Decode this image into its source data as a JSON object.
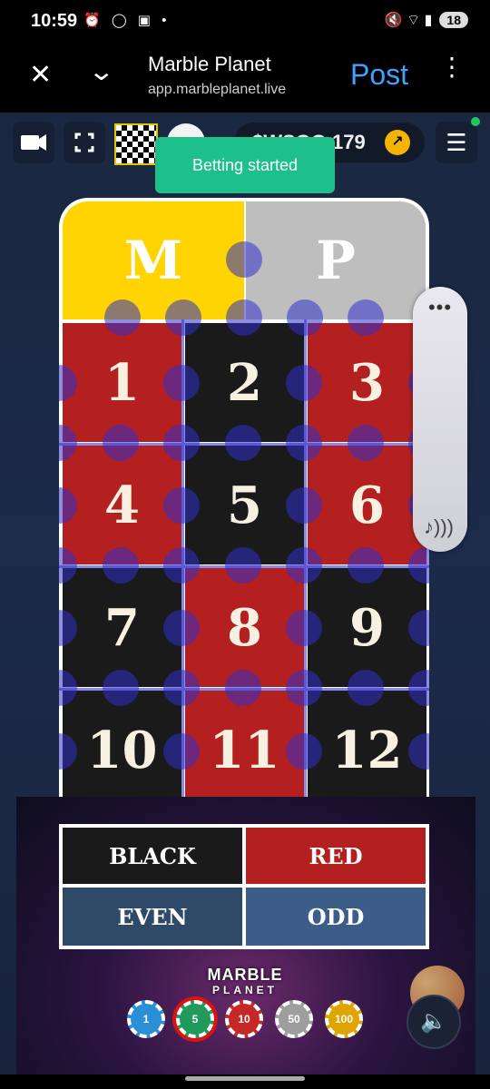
{
  "status_bar": {
    "time": "10:59",
    "left_icons": "⏰ ◯ ▣ •",
    "right_icons": "🔇 ⌔ ▮",
    "battery": "18"
  },
  "browser": {
    "title": "Marble Planet",
    "url": "app.marbleplanet.live",
    "post_label": "Post",
    "close_icon": "✕",
    "chevron_icon": "⌄",
    "menu_icon": "⋮"
  },
  "game": {
    "balance": "$WSOO 179",
    "balance_arrow": "↗",
    "menu_icon": "☰",
    "toast": "Betting started",
    "top_cells": [
      "M",
      "P"
    ],
    "numbers": [
      {
        "n": "1",
        "color": "red"
      },
      {
        "n": "2",
        "color": "black"
      },
      {
        "n": "3",
        "color": "red"
      },
      {
        "n": "4",
        "color": "red"
      },
      {
        "n": "5",
        "color": "black"
      },
      {
        "n": "6",
        "color": "red"
      },
      {
        "n": "7",
        "color": "black"
      },
      {
        "n": "8",
        "color": "red"
      },
      {
        "n": "9",
        "color": "black"
      },
      {
        "n": "10",
        "color": "black"
      },
      {
        "n": "11",
        "color": "red"
      },
      {
        "n": "12",
        "color": "black"
      }
    ],
    "bets": {
      "black": "BLACK",
      "red": "RED",
      "even": "EVEN",
      "odd": "ODD"
    },
    "logo_main": "MARBLE",
    "logo_sub": "PLANET",
    "chips": [
      {
        "value": "1",
        "color": "#2a8fd6"
      },
      {
        "value": "5",
        "color": "#1f9a5a"
      },
      {
        "value": "10",
        "color": "#c62828"
      },
      {
        "value": "50",
        "color": "#9e9e9e"
      },
      {
        "value": "100",
        "color": "#e0a400"
      }
    ],
    "selected_chip": "5",
    "side_panel_dots": "•••",
    "side_panel_sound": "♪)))",
    "sound_icon": "🔈"
  }
}
